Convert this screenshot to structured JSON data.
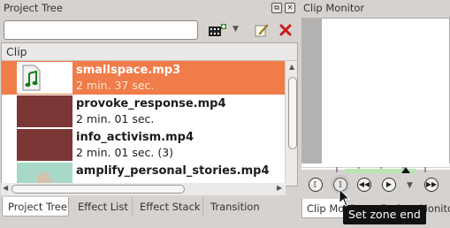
{
  "project_tree": {
    "title": "Project Tree",
    "search": {
      "value": "",
      "placeholder": ""
    },
    "column_header": "Clip",
    "clips": [
      {
        "name": "smallspace.mp3",
        "duration": "2 min. 37 sec.",
        "selected": true,
        "thumb_color": "#ffffff",
        "icon": "audio-note-icon"
      },
      {
        "name": "provoke_response.mp4",
        "duration": "2 min. 01 sec.",
        "selected": false,
        "thumb_color": "#7b3636"
      },
      {
        "name": "info_activism.mp4",
        "duration": "2 min. 01 sec. (3)",
        "selected": false,
        "thumb_color": "#7b3636"
      },
      {
        "name": "amplify_personal_stories.mp4",
        "duration": "",
        "selected": false,
        "thumb_color": "#a8d8c8"
      }
    ],
    "tabs": [
      "Project Tree",
      "Effect List",
      "Effect Stack",
      "Transition"
    ]
  },
  "clip_monitor": {
    "title": "Clip Monitor",
    "tabs": [
      "Clip Monitor",
      "Project Monitor"
    ],
    "tooltip": "Set zone end"
  },
  "colors": {
    "selection": "#f07c49",
    "background": "#d6d2d0",
    "zone": "#b7e6b0"
  }
}
